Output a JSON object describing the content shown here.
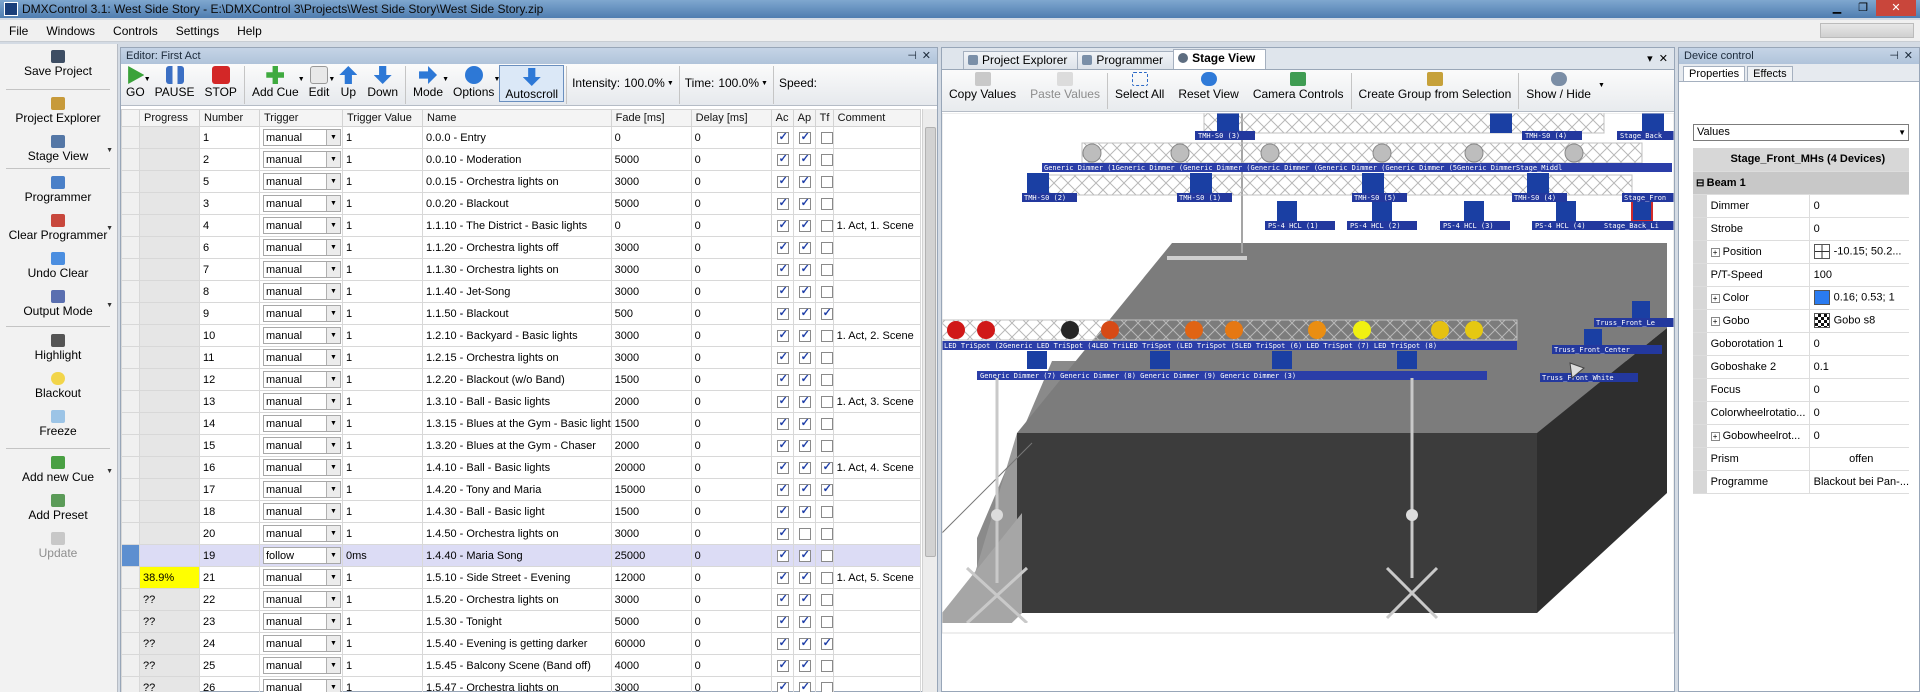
{
  "window": {
    "title": "DMXControl 3.1: West Side Story - E:\\DMXControl 3\\Projects\\West Side Story\\West Side Story.zip"
  },
  "menu": [
    "File",
    "Windows",
    "Controls",
    "Settings",
    "Help"
  ],
  "sidebar": [
    {
      "label": "Save Project"
    },
    {
      "label": "Project Explorer"
    },
    {
      "label": "Stage View"
    },
    {
      "label": "Programmer"
    },
    {
      "label": "Clear Programmer"
    },
    {
      "label": "Undo Clear"
    },
    {
      "label": "Output Mode"
    },
    {
      "label": "Highlight"
    },
    {
      "label": "Blackout"
    },
    {
      "label": "Freeze"
    },
    {
      "label": "Add new Cue"
    },
    {
      "label": "Add Preset"
    },
    {
      "label": "Update"
    }
  ],
  "editor": {
    "title": "Editor: First Act",
    "toolbar": {
      "go": "GO",
      "pause": "PAUSE",
      "stop": "STOP",
      "add_cue": "Add Cue",
      "edit": "Edit",
      "up": "Up",
      "down": "Down",
      "mode": "Mode",
      "options": "Options",
      "autoscroll": "Autoscroll",
      "intensity_label": "Intensity:",
      "intensity_value": "100.0%",
      "time_label": "Time:",
      "time_value": "100.0%",
      "speed_label": "Speed:"
    },
    "columns": [
      "Progress",
      "Number",
      "Trigger",
      "Trigger Value",
      "Name",
      "Fade [ms]",
      "Delay [ms]",
      "Ac",
      "Ap",
      "Tf",
      "Comment"
    ],
    "rows": [
      {
        "progress": "",
        "number": "1",
        "trigger": "manual",
        "trigger_value": "1",
        "name": "0.0.0 - Entry",
        "fade": "0",
        "delay": "0",
        "ac": true,
        "ap": true,
        "tf": false,
        "comment": ""
      },
      {
        "progress": "",
        "number": "2",
        "trigger": "manual",
        "trigger_value": "1",
        "name": "0.0.10 - Moderation",
        "fade": "5000",
        "delay": "0",
        "ac": true,
        "ap": true,
        "tf": false,
        "comment": ""
      },
      {
        "progress": "",
        "number": "5",
        "trigger": "manual",
        "trigger_value": "1",
        "name": "0.0.15 - Orchestra lights on",
        "fade": "3000",
        "delay": "0",
        "ac": true,
        "ap": true,
        "tf": false,
        "comment": ""
      },
      {
        "progress": "",
        "number": "3",
        "trigger": "manual",
        "trigger_value": "1",
        "name": "0.0.20 - Blackout",
        "fade": "5000",
        "delay": "0",
        "ac": true,
        "ap": true,
        "tf": false,
        "comment": ""
      },
      {
        "progress": "",
        "number": "4",
        "trigger": "manual",
        "trigger_value": "1",
        "name": "1.1.10 - The District - Basic lights",
        "fade": "0",
        "delay": "0",
        "ac": true,
        "ap": true,
        "tf": false,
        "comment": "1. Act, 1. Scene"
      },
      {
        "progress": "",
        "number": "6",
        "trigger": "manual",
        "trigger_value": "1",
        "name": "1.1.20 - Orchestra lights off",
        "fade": "3000",
        "delay": "0",
        "ac": true,
        "ap": true,
        "tf": false,
        "comment": ""
      },
      {
        "progress": "",
        "number": "7",
        "trigger": "manual",
        "trigger_value": "1",
        "name": "1.1.30 - Orchestra lights on",
        "fade": "3000",
        "delay": "0",
        "ac": true,
        "ap": true,
        "tf": false,
        "comment": ""
      },
      {
        "progress": "",
        "number": "8",
        "trigger": "manual",
        "trigger_value": "1",
        "name": "1.1.40 - Jet-Song",
        "fade": "3000",
        "delay": "0",
        "ac": true,
        "ap": true,
        "tf": false,
        "comment": ""
      },
      {
        "progress": "",
        "number": "9",
        "trigger": "manual",
        "trigger_value": "1",
        "name": "1.1.50 - Blackout",
        "fade": "500",
        "delay": "0",
        "ac": true,
        "ap": true,
        "tf": true,
        "comment": ""
      },
      {
        "progress": "",
        "number": "10",
        "trigger": "manual",
        "trigger_value": "1",
        "name": "1.2.10 - Backyard - Basic lights",
        "fade": "3000",
        "delay": "0",
        "ac": true,
        "ap": true,
        "tf": false,
        "comment": "1. Act, 2. Scene"
      },
      {
        "progress": "",
        "number": "11",
        "trigger": "manual",
        "trigger_value": "1",
        "name": "1.2.15 - Orchestra lights on",
        "fade": "3000",
        "delay": "0",
        "ac": true,
        "ap": true,
        "tf": false,
        "comment": ""
      },
      {
        "progress": "",
        "number": "12",
        "trigger": "manual",
        "trigger_value": "1",
        "name": "1.2.20 - Blackout (w/o Band)",
        "fade": "1500",
        "delay": "0",
        "ac": true,
        "ap": true,
        "tf": false,
        "comment": ""
      },
      {
        "progress": "",
        "number": "13",
        "trigger": "manual",
        "trigger_value": "1",
        "name": "1.3.10 - Ball - Basic lights",
        "fade": "2000",
        "delay": "0",
        "ac": true,
        "ap": true,
        "tf": false,
        "comment": "1. Act, 3. Scene"
      },
      {
        "progress": "",
        "number": "14",
        "trigger": "manual",
        "trigger_value": "1",
        "name": "1.3.15 - Blues at the Gym - Basic light",
        "fade": "1500",
        "delay": "0",
        "ac": true,
        "ap": true,
        "tf": false,
        "comment": ""
      },
      {
        "progress": "",
        "number": "15",
        "trigger": "manual",
        "trigger_value": "1",
        "name": "1.3.20 - Blues at the Gym - Chaser",
        "fade": "2000",
        "delay": "0",
        "ac": true,
        "ap": true,
        "tf": false,
        "comment": ""
      },
      {
        "progress": "",
        "number": "16",
        "trigger": "manual",
        "trigger_value": "1",
        "name": "1.4.10 - Ball - Basic lights",
        "fade": "20000",
        "delay": "0",
        "ac": true,
        "ap": true,
        "tf": true,
        "comment": "1. Act, 4. Scene"
      },
      {
        "progress": "",
        "number": "17",
        "trigger": "manual",
        "trigger_value": "1",
        "name": "1.4.20 - Tony and Maria",
        "fade": "15000",
        "delay": "0",
        "ac": true,
        "ap": true,
        "tf": true,
        "comment": ""
      },
      {
        "progress": "",
        "number": "18",
        "trigger": "manual",
        "trigger_value": "1",
        "name": "1.4.30 - Ball - Basic light",
        "fade": "1500",
        "delay": "0",
        "ac": true,
        "ap": true,
        "tf": false,
        "comment": ""
      },
      {
        "progress": "",
        "number": "20",
        "trigger": "manual",
        "trigger_value": "1",
        "name": "1.4.50 - Orchestra lights on",
        "fade": "3000",
        "delay": "0",
        "ac": true,
        "ap": false,
        "tf": false,
        "comment": ""
      },
      {
        "progress": "",
        "number": "19",
        "trigger": "follow",
        "trigger_value": "0ms",
        "name": "1.4.40 - Maria Song",
        "fade": "25000",
        "delay": "0",
        "ac": true,
        "ap": true,
        "tf": false,
        "comment": "",
        "active": true
      },
      {
        "progress": "38.9%",
        "number": "21",
        "trigger": "manual",
        "trigger_value": "1",
        "name": "1.5.10 - Side Street - Evening",
        "fade": "12000",
        "delay": "0",
        "ac": true,
        "ap": true,
        "tf": false,
        "comment": "1. Act, 5. Scene",
        "current": true
      },
      {
        "progress": "??",
        "number": "22",
        "trigger": "manual",
        "trigger_value": "1",
        "name": "1.5.20 - Orchestra lights on",
        "fade": "3000",
        "delay": "0",
        "ac": true,
        "ap": true,
        "tf": false,
        "comment": ""
      },
      {
        "progress": "??",
        "number": "23",
        "trigger": "manual",
        "trigger_value": "1",
        "name": "1.5.30 - Tonight",
        "fade": "5000",
        "delay": "0",
        "ac": true,
        "ap": true,
        "tf": false,
        "comment": ""
      },
      {
        "progress": "??",
        "number": "24",
        "trigger": "manual",
        "trigger_value": "1",
        "name": "1.5.40 - Evening is getting darker",
        "fade": "60000",
        "delay": "0",
        "ac": true,
        "ap": true,
        "tf": true,
        "comment": ""
      },
      {
        "progress": "??",
        "number": "25",
        "trigger": "manual",
        "trigger_value": "1",
        "name": "1.5.45 - Balcony Scene (Band off)",
        "fade": "4000",
        "delay": "0",
        "ac": true,
        "ap": true,
        "tf": false,
        "comment": ""
      },
      {
        "progress": "??",
        "number": "26",
        "trigger": "manual",
        "trigger_value": "1",
        "name": "1.5.47 - Orchestra lights on",
        "fade": "3000",
        "delay": "0",
        "ac": true,
        "ap": true,
        "tf": false,
        "comment": ""
      }
    ]
  },
  "stage": {
    "tabs": [
      "Project Explorer",
      "Programmer",
      "Stage View"
    ],
    "toolbar": [
      "Copy Values",
      "Paste Values",
      "Select All",
      "Reset View",
      "Camera Controls",
      "Create Group from Selection",
      "Show / Hide"
    ],
    "labels": {
      "tmh_1": "TMH-S0 (3)",
      "tmh_2": "TMH-S0 (4)",
      "tmh_3": "TMH-S0 (2)",
      "tmh_4": "TMH-S0 (1)",
      "tmh_5": "TMH-S0 (5)",
      "tmh_6": "TMH-S0 (4)",
      "dim_top": "Generic Dimmer (1Generic Dimmer (Generic Dimmer (Generic Dimmer (Generic Dimmer (Generic Dimmer (5Generic DimmerStage_Middl",
      "ps1": "PS-4 HCL (1)",
      "ps2": "PS-4 HCL (2)",
      "ps3": "PS-4 HCL (3)",
      "ps4": "PS-4 HCL (4)",
      "stage_back": "Stage_Back_Li",
      "stage_front": "Stage_Fron",
      "stage_back_top": "Stage_Back",
      "led_row": "LED TriSpot (2Generic LED TriSpot (4LED TriLED TriSpot (LED TriSpot (5LED TriSpot (6) LED TriSpot (7) LED TriSpot (8)",
      "dim_bottom": "Generic Dimmer (7)     Generic Dimmer (8)     Generic Dimmer (9)     Generic Dimmer (3)",
      "truss_left": "Truss_Front_Le",
      "truss_center": "Truss_Front_Center",
      "truss_white": "Truss_Front_White"
    }
  },
  "device": {
    "title": "Device control",
    "tabs": [
      "Properties",
      "Effects"
    ],
    "select": "Values",
    "device_name": "Stage_Front_MHs (4 Devices)",
    "group": "Beam 1",
    "props": [
      {
        "name": "Dimmer",
        "value": "0"
      },
      {
        "name": "Strobe",
        "value": "0"
      },
      {
        "name": "Position",
        "value": "-10.15; 50.2...",
        "expand": true,
        "icon": "pos"
      },
      {
        "name": "P/T-Speed",
        "value": "100"
      },
      {
        "name": "Color",
        "value": "0.16; 0.53; 1",
        "expand": true,
        "icon": "color",
        "color": "#2a7bf0"
      },
      {
        "name": "Gobo",
        "value": "Gobo s8",
        "expand": true,
        "icon": "gobo"
      },
      {
        "name": "Goborotation 1",
        "value": "0"
      },
      {
        "name": "Goboshake 2",
        "value": "0.1"
      },
      {
        "name": "Focus",
        "value": "0"
      },
      {
        "name": "Colorwheelrotatio...",
        "value": "0"
      },
      {
        "name": "Gobowheelrot...",
        "value": "0",
        "expand": true
      },
      {
        "name": "Prism",
        "value": "offen",
        "center": true
      },
      {
        "name": "Programme",
        "value": "Blackout bei Pan-..."
      }
    ]
  }
}
